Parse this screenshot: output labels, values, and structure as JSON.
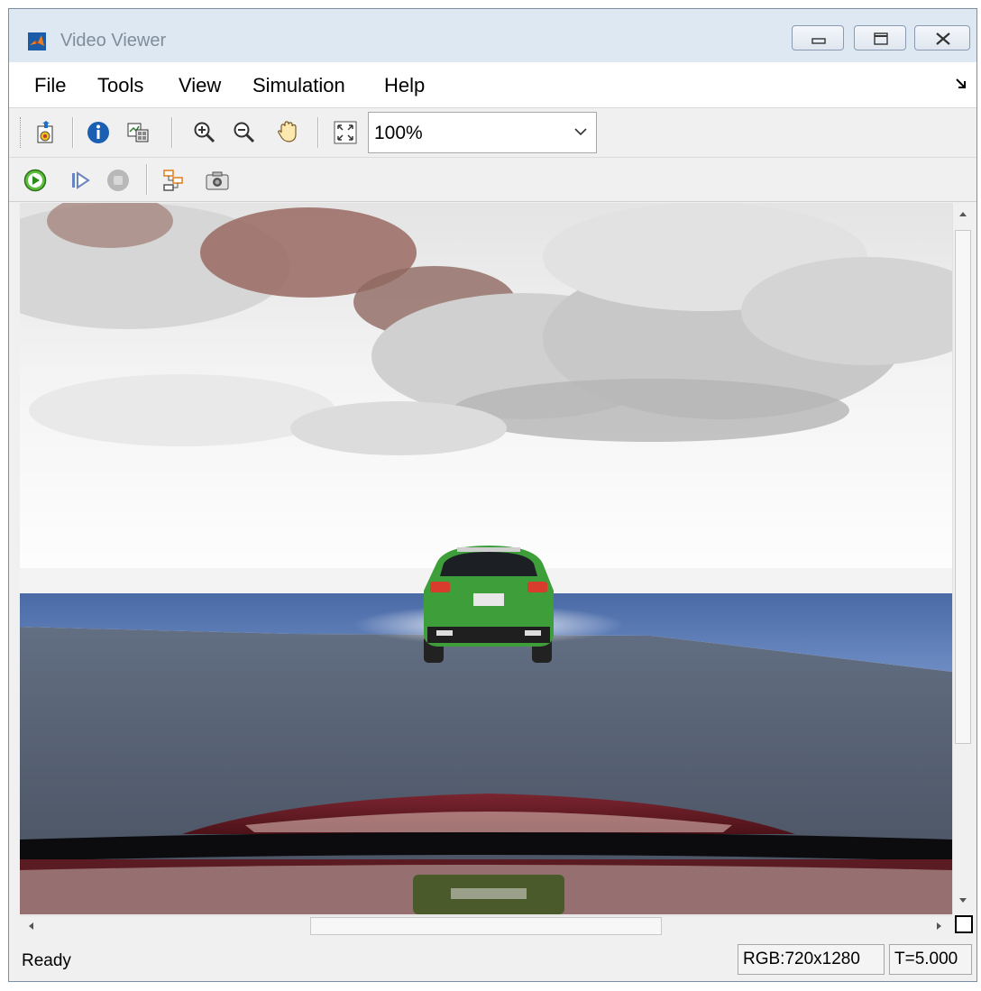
{
  "window": {
    "title": "Video Viewer"
  },
  "menu": [
    "File",
    "Tools",
    "View",
    "Simulation",
    "Help"
  ],
  "toolbar": {
    "icons": [
      "parameters-icon",
      "info-icon",
      "open-scope-icon",
      "zoom-in-icon",
      "zoom-out-icon",
      "pan-hand-icon",
      "fit-to-view-icon"
    ],
    "zoom_value": "100%"
  },
  "playback": {
    "icons": [
      "run-icon",
      "step-forward-icon",
      "stop-icon",
      "highlight-block-icon",
      "snapshot-icon"
    ]
  },
  "status": {
    "text": "Ready",
    "dims": "RGB:720x1280",
    "time": "T=5.000"
  },
  "colors": {
    "titlebar": "#dde8f3",
    "road": "#5a6578",
    "lead_car": "#3e9e3a",
    "ego_hood": "#6a1d24",
    "water": "#4a6da8"
  }
}
